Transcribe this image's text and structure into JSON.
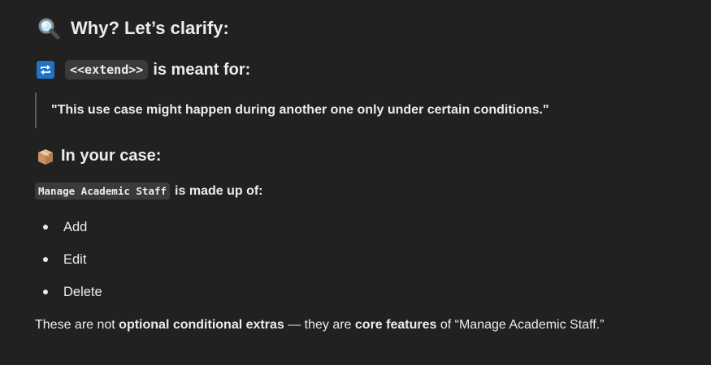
{
  "section1": {
    "icon": "magnifying-glass-icon",
    "title": "Why? Let’s clarify:"
  },
  "section2": {
    "icon": "repeat-arrows-icon",
    "code": "<<extend>>",
    "title_suffix": "is meant for:"
  },
  "quote": "\"This use case might happen during another one only under certain conditions.\"",
  "section3": {
    "icon": "package-box-icon",
    "title": "In your case:"
  },
  "made_up": {
    "code": "Manage Academic Staff",
    "suffix": "is made up of:"
  },
  "items": [
    "Add",
    "Edit",
    "Delete"
  ],
  "summary": {
    "part1": "These are not ",
    "bold1": "optional conditional extras",
    "part2": " — they are ",
    "bold2": "core features",
    "part3": " of “Manage Academic Staff.”"
  },
  "colors": {
    "background": "#212121",
    "text": "#ececec",
    "code_bg": "#3a3a3a",
    "repeat_icon": "#1e73c8"
  }
}
